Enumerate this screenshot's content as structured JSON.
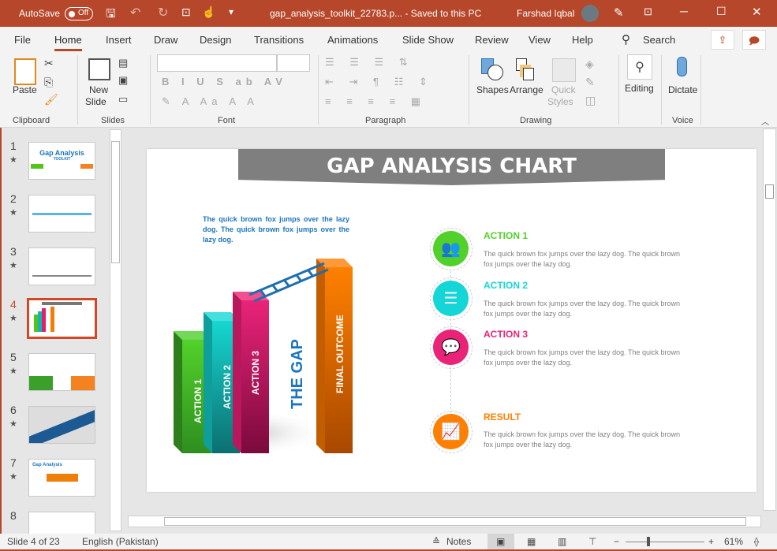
{
  "titlebar": {
    "autosave_label": "AutoSave",
    "autosave_state": "Off",
    "doc_title": "gap_analysis_toolkit_22783.p...  -  Saved to this PC",
    "user_name": "Farshad Iqbal"
  },
  "tabs": [
    "File",
    "Home",
    "Insert",
    "Draw",
    "Design",
    "Transitions",
    "Animations",
    "Slide Show",
    "Review",
    "View",
    "Help"
  ],
  "search_label": "Search",
  "ribbon": {
    "groups": [
      "Clipboard",
      "Slides",
      "Font",
      "Paragraph",
      "Drawing",
      "Voice"
    ],
    "paste": "Paste",
    "new_slide": "New",
    "new_slide2": "Slide",
    "shapes": "Shapes",
    "arrange": "Arrange",
    "quick": "Quick",
    "styles": "Styles",
    "editing": "Editing",
    "dictate": "Dictate",
    "font_buttons": "B  I  U  S  ab  AV"
  },
  "thumbnails": [
    {
      "num": "1",
      "title": "Gap Analysis",
      "sub": "TOOLKIT"
    },
    {
      "num": "2"
    },
    {
      "num": "3"
    },
    {
      "num": "4",
      "selected": true
    },
    {
      "num": "5"
    },
    {
      "num": "6"
    },
    {
      "num": "7",
      "title": "Gap Analysis"
    },
    {
      "num": "8"
    }
  ],
  "slide": {
    "title": "GAP ANALYSIS CHART",
    "intro": "The quick brown fox jumps over the lazy dog. The quick brown fox jumps over the lazy dog.",
    "bars": [
      "ACTION 1",
      "ACTION 2",
      "ACTION 3",
      "FINAL OUTCOME"
    ],
    "gap_label": "THE GAP",
    "items": [
      {
        "title": "ACTION 1",
        "text": "The quick brown fox jumps over the lazy dog. The quick brown fox jumps over the lazy dog.",
        "color": "#52d12a",
        "icon": "group-icon"
      },
      {
        "title": "ACTION 2",
        "text": "The quick brown fox jumps over the lazy dog. The quick brown fox jumps over the lazy dog.",
        "color": "#14d6d6",
        "icon": "list-icon"
      },
      {
        "title": "ACTION 3",
        "text": "The quick brown fox jumps over the lazy dog. The quick brown fox jumps over the lazy dog.",
        "color": "#ea2379",
        "icon": "chat-icon"
      },
      {
        "title": "RESULT",
        "text": "The quick brown fox jumps over the lazy dog. The quick brown fox jumps over the lazy dog.",
        "color": "#ff8000",
        "icon": "trend-chart-icon"
      }
    ]
  },
  "status": {
    "slide": "Slide 4 of 23",
    "language": "English (Pakistan)",
    "notes": "Notes",
    "zoom": "61%",
    "zoom_percent": 61
  }
}
